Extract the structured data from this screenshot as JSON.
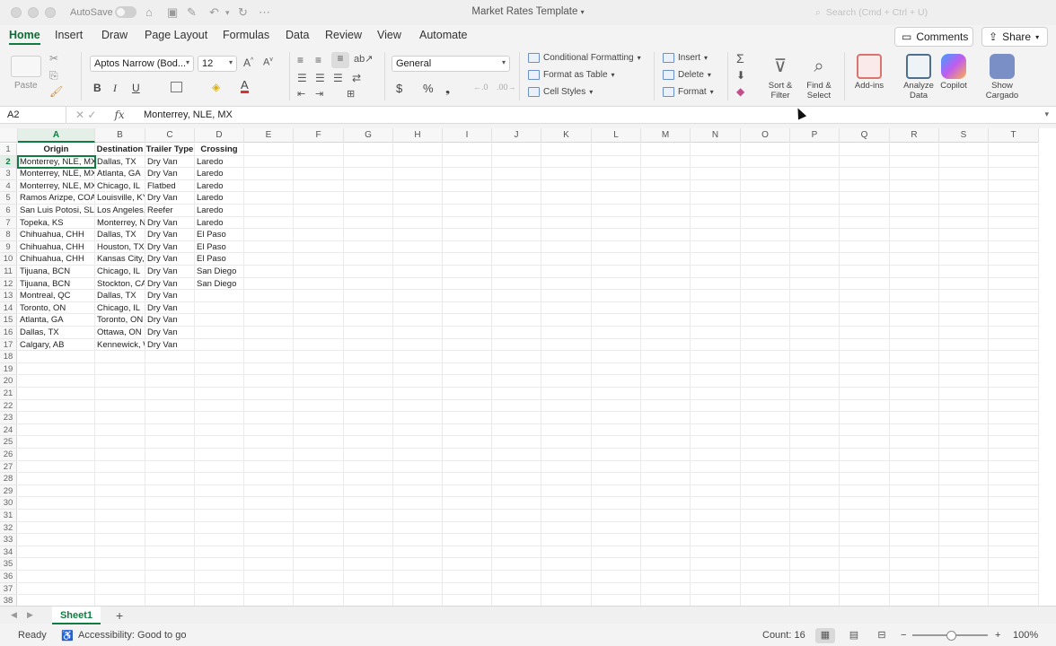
{
  "titlebar": {
    "autosave_label": "AutoSave",
    "doc_title": "Market Rates Template",
    "search_placeholder": "Search (Cmd + Ctrl + U)"
  },
  "tabs": [
    "Home",
    "Insert",
    "Draw",
    "Page Layout",
    "Formulas",
    "Data",
    "Review",
    "View",
    "Automate"
  ],
  "actions": {
    "comments": "Comments",
    "share": "Share"
  },
  "ribbon": {
    "paste": "Paste",
    "font_name": "Aptos Narrow (Bod...",
    "font_size": "12",
    "number_format": "General",
    "conditional_formatting": "Conditional Formatting",
    "format_as_table": "Format as Table",
    "cell_styles": "Cell Styles",
    "insert": "Insert",
    "delete": "Delete",
    "format": "Format",
    "sort_filter": "Sort & Filter",
    "find_select": "Find & Select",
    "add_ins": "Add-ins",
    "analyze_data": "Analyze Data",
    "copilot": "Copilot",
    "show_cargado": "Show Cargado",
    "bold": "B",
    "italic": "I",
    "underline": "U",
    "currency": "$",
    "percent": "%"
  },
  "formula_bar": {
    "name_box": "A2",
    "fx": "fx",
    "value": "Monterrey, NLE, MX"
  },
  "columns": [
    "A",
    "B",
    "C",
    "D",
    "E",
    "F",
    "G",
    "H",
    "I",
    "J",
    "K",
    "L",
    "M",
    "N",
    "O",
    "P",
    "Q",
    "R",
    "S",
    "T"
  ],
  "rows_count": 38,
  "table": {
    "headers": [
      "Origin",
      "Destination",
      "Trailer Type",
      "Crossing"
    ],
    "rows": [
      [
        "Monterrey, NLE, MX",
        "Dallas, TX",
        "Dry Van",
        "Laredo"
      ],
      [
        "Monterrey, NLE, MX",
        "Atlanta, GA",
        "Dry Van",
        "Laredo"
      ],
      [
        "Monterrey, NLE, MX",
        "Chicago, IL",
        "Flatbed",
        "Laredo"
      ],
      [
        "Ramos Arizpe, COA",
        "Louisville, KY",
        "Dry Van",
        "Laredo"
      ],
      [
        "San Luis Potosi, SLP",
        "Los Angeles, CA",
        "Reefer",
        "Laredo"
      ],
      [
        "Topeka, KS",
        "Monterrey, NLE",
        "Dry Van",
        "Laredo"
      ],
      [
        "Chihuahua, CHH",
        "Dallas, TX",
        "Dry Van",
        "El Paso"
      ],
      [
        "Chihuahua, CHH",
        "Houston, TX",
        "Dry Van",
        "El Paso"
      ],
      [
        "Chihuahua, CHH",
        "Kansas City, MO",
        "Dry Van",
        "El Paso"
      ],
      [
        "Tijuana, BCN",
        "Chicago, IL",
        "Dry Van",
        "San Diego"
      ],
      [
        "Tijuana, BCN",
        "Stockton, CA",
        "Dry Van",
        "San Diego"
      ],
      [
        "Montreal, QC",
        "Dallas, TX",
        "Dry Van",
        ""
      ],
      [
        "Toronto, ON",
        "Chicago, IL",
        "Dry Van",
        ""
      ],
      [
        "Atlanta, GA",
        "Toronto, ON",
        "Dry Van",
        ""
      ],
      [
        "Dallas, TX",
        "Ottawa, ON",
        "Dry Van",
        ""
      ],
      [
        "Calgary, AB",
        "Kennewick, WA",
        "Dry Van",
        ""
      ]
    ]
  },
  "sheet_tabs": [
    "Sheet1"
  ],
  "status": {
    "ready": "Ready",
    "accessibility": "Accessibility: Good to go",
    "count": "Count: 16",
    "zoom": "100%"
  },
  "colors": {
    "accent": "#107c41"
  }
}
